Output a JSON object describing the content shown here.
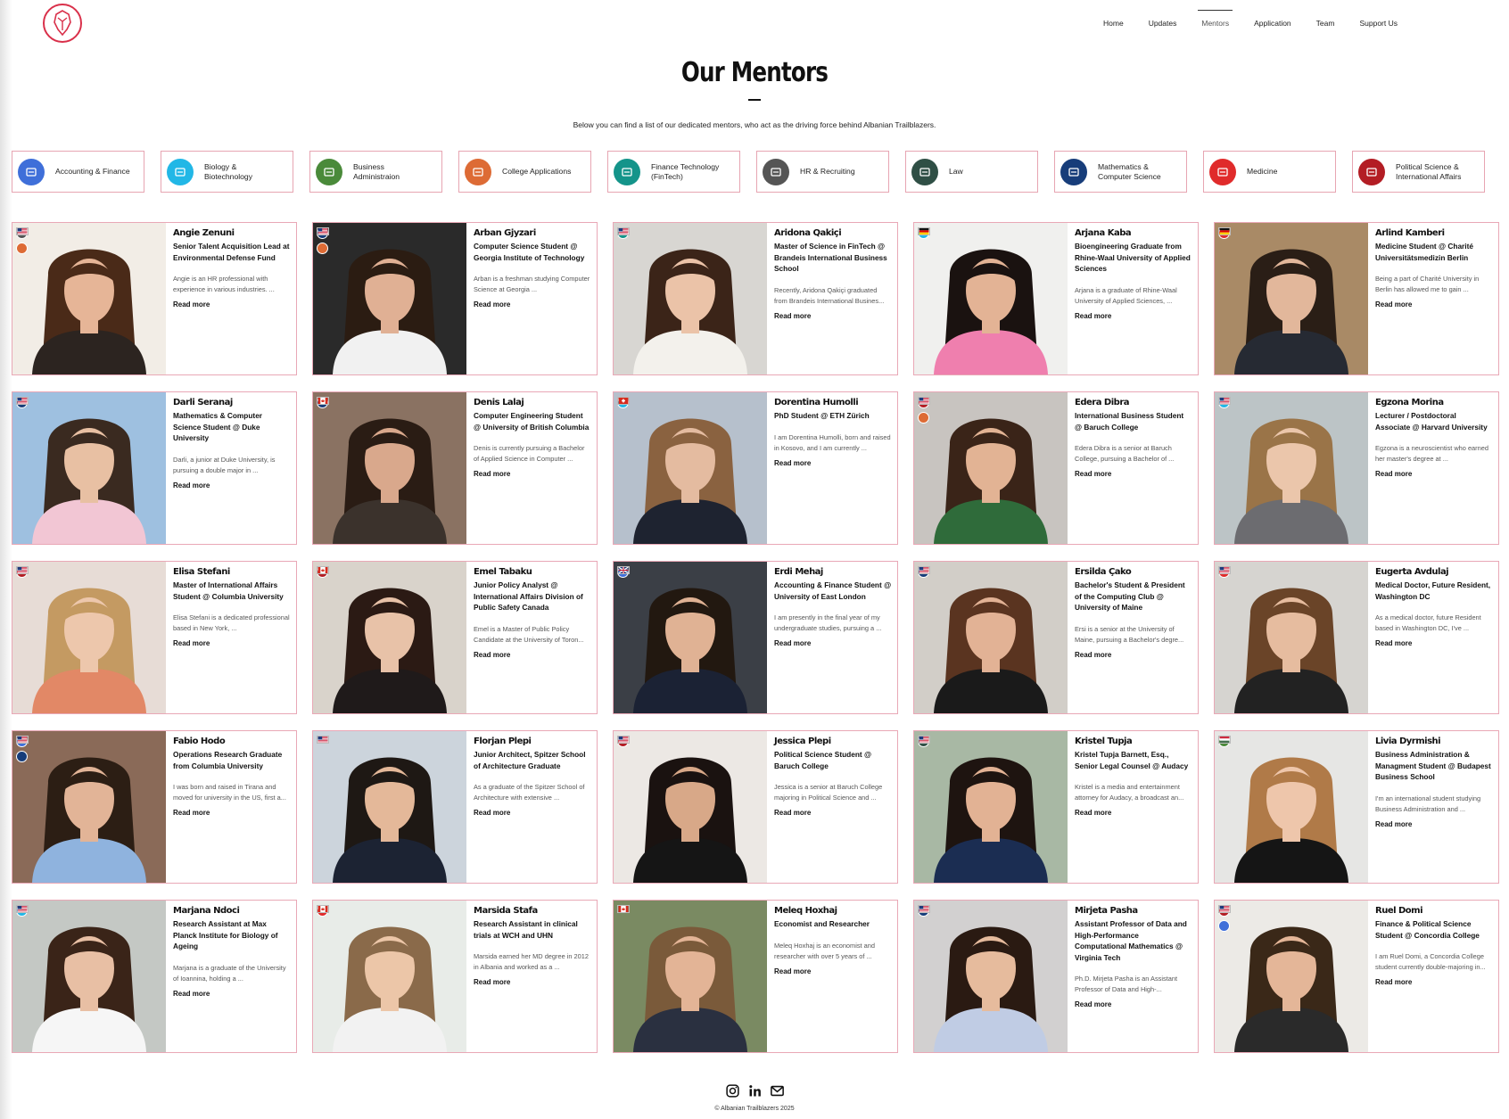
{
  "nav": [
    "Home",
    "Updates",
    "Mentors",
    "Application",
    "Team",
    "Support Us"
  ],
  "active_nav": "Mentors",
  "page": {
    "title": "Our Mentors",
    "subtitle": "Below you can find a list of our dedicated mentors, who act as the driving force behind Albanian Trailblazers."
  },
  "categories": [
    {
      "label": "Accounting & Finance",
      "color": "#3f6fd9",
      "icon": "money-icon"
    },
    {
      "label": "Biology &\nBiotechnology",
      "color": "#22b7e6",
      "icon": "microscope-icon"
    },
    {
      "label": "Business\nAdministraion",
      "color": "#4a8a3a",
      "icon": "building-icon"
    },
    {
      "label": "College Applications",
      "color": "#dd6b35",
      "icon": "college-icon"
    },
    {
      "label": "Finance Technology\n(FinTech)",
      "color": "#14948a",
      "icon": "fintech-icon"
    },
    {
      "label": "HR & Recruiting",
      "color": "#555555",
      "icon": "hr-icon"
    },
    {
      "label": "Law",
      "color": "#2f4f45",
      "icon": "scales-icon"
    },
    {
      "label": "Mathematics &\nComputer Science",
      "color": "#173d7a",
      "icon": "computer-icon"
    },
    {
      "label": "Medicine",
      "color": "#e02b2b",
      "icon": "medicine-icon"
    },
    {
      "label": "Political Science &\nInternational Affairs",
      "color": "#b31d24",
      "icon": "capitol-icon"
    }
  ],
  "read_more_label": "Read more",
  "mentors": [
    {
      "name": "Angie Zenuni",
      "role": "Senior Talent Acquisition Lead at Environmental Defense Fund",
      "bio": "Angie is an HR professional with experience in various industries. ...",
      "flag": "us",
      "badges": [
        "#555555",
        "#dd6b35"
      ],
      "bg": "#f2ede6",
      "skin": "#e6b597",
      "hair": "#4a2a18",
      "top": "#2c2420"
    },
    {
      "name": "Arban Gjyzari",
      "role": "Computer Science Student @ Georgia Institute of Technology",
      "bio": "Arban is a freshman studying Computer Science at Georgia ...",
      "flag": "us",
      "badges": [
        "#173d7a",
        "#dd6b35"
      ],
      "bg": "#2a2a2a",
      "skin": "#e0b094",
      "hair": "#2b1c12",
      "top": "#f1f1f1"
    },
    {
      "name": "Aridona Qakiçi",
      "role": "Master of Science in FinTech @ Brandeis International Business School",
      "bio": "Recently, Aridona Qakiçi graduated from Brandeis International Busines...",
      "flag": "us",
      "badges": [
        "#14948a"
      ],
      "bg": "#d8d6d2",
      "skin": "#ebc3a8",
      "hair": "#3b2418",
      "top": "#f3f1ec"
    },
    {
      "name": "Arjana Kaba",
      "role": "Bioengineering Graduate from Rhine-Waal University of Applied Sciences",
      "bio": "Arjana is a graduate of Rhine-Waal University of Applied Sciences, ...",
      "flag": "de",
      "badges": [
        "#22b7e6"
      ],
      "bg": "#f0f0ee",
      "skin": "#e3b395",
      "hair": "#1a1210",
      "top": "#ef7fae"
    },
    {
      "name": "Arlind Kamberi",
      "role": "Medicine Student @ Charité Universitätsmedizin Berlin",
      "bio": "Being a part of Charité University in Berlin has allowed me to gain ...",
      "flag": "de",
      "badges": [
        "#e02b2b"
      ],
      "bg": "#a98a66",
      "skin": "#e2b79b",
      "hair": "#2a1e16",
      "top": "#262a33"
    },
    {
      "name": "Darli Seranaj",
      "role": "Mathematics & Computer Science Student @ Duke University",
      "bio": "Darli, a junior at Duke University, is pursuing a double major in ...",
      "flag": "us",
      "badges": [
        "#173d7a"
      ],
      "bg": "#9ec0e0",
      "skin": "#e8c0a3",
      "hair": "#3a2a20",
      "top": "#f2c6d4"
    },
    {
      "name": "Denis Lalaj",
      "role": "Computer Engineering Student @ University of British Columbia",
      "bio": "Denis is currently pursuing a Bachelor of Applied Science in Computer ...",
      "flag": "ca",
      "badges": [
        "#173d7a"
      ],
      "bg": "#8a7262",
      "skin": "#d9a88c",
      "hair": "#2a1c14",
      "top": "#3b322c"
    },
    {
      "name": "Dorentina Humolli",
      "role": "PhD Student @ ETH Zürich",
      "bio": "I am Dorentina Humolli, born and raised in Kosovo, and I am currently ...",
      "flag": "ch",
      "badges": [
        "#22b7e6"
      ],
      "bg": "#b6c0cc",
      "skin": "#e4bba0",
      "hair": "#8a6240",
      "top": "#1e2330"
    },
    {
      "name": "Edera Dibra",
      "role": "International Business Student @ Baruch College",
      "bio": "Edera Dibra is a senior at Baruch College, pursuing a Bachelor of ...",
      "flag": "us",
      "badges": [
        "#b31d24",
        "#dd6b35"
      ],
      "bg": "#c8c4c0",
      "skin": "#e2b394",
      "hair": "#3a2418",
      "top": "#2f6b3a"
    },
    {
      "name": "Egzona Morina",
      "role": "Lecturer / Postdoctoral Associate @ Harvard University",
      "bio": "Egzona is a neuroscientist who earned her master's degree at ...",
      "flag": "us",
      "badges": [
        "#22b7e6"
      ],
      "bg": "#bcc4c6",
      "skin": "#ebc6ab",
      "hair": "#9a7448",
      "top": "#6c6c70"
    },
    {
      "name": "Elisa Stefani",
      "role": "Master of International Affairs Student @ Columbia University",
      "bio": "Elisa Stefani is a dedicated professional based in New York, ...",
      "flag": "us",
      "badges": [
        "#b31d24"
      ],
      "bg": "#e7dcd6",
      "skin": "#edc7ac",
      "hair": "#c49a62",
      "top": "#e28866"
    },
    {
      "name": "Emel Tabaku",
      "role": "Junior Policy Analyst @ International Affairs Division of Public Safety Canada",
      "bio": "Emel is a Master of Public Policy Candidate at the University of Toron...",
      "flag": "ca",
      "badges": [
        "#b31d24"
      ],
      "bg": "#d9d3cb",
      "skin": "#e8c2a8",
      "hair": "#2b1a14",
      "top": "#1f1a1a"
    },
    {
      "name": "Erdi Mehaj",
      "role": "Accounting & Finance Student @ University of East London",
      "bio": "I am presently in the final year of my undergraduate studies, pursuing a ...",
      "flag": "gb",
      "badges": [
        "#3f6fd9"
      ],
      "bg": "#3b3f46",
      "skin": "#e0b294",
      "hair": "#221810",
      "top": "#1b2234"
    },
    {
      "name": "Ersilda Çako",
      "role": "Bachelor's Student & President of the Computing Club @ University of Maine",
      "bio": "Ersi is a senior at the University of Maine, pursuing a Bachelor's degre...",
      "flag": "us",
      "badges": [
        "#173d7a"
      ],
      "bg": "#d2cec8",
      "skin": "#e2b295",
      "hair": "#5a3420",
      "top": "#1a1a1a"
    },
    {
      "name": "Eugerta Avdulaj",
      "role": "Medical Doctor, Future Resident, Washington DC",
      "bio": "As a medical doctor, future Resident based in Washington DC, I've ...",
      "flag": "us",
      "badges": [
        "#e02b2b"
      ],
      "bg": "#d6d4d0",
      "skin": "#e6bc9f",
      "hair": "#6a4428",
      "top": "#222222"
    },
    {
      "name": "Fabio Hodo",
      "role": "Operations Research Graduate from Columbia University",
      "bio": "I was born and raised in Tirana and moved for university in the US, first a...",
      "flag": "us",
      "badges": [
        "#3f6fd9",
        "#173d7a"
      ],
      "bg": "#8a6a58",
      "skin": "#e2b497",
      "hair": "#2c1e14",
      "top": "#8fb3de"
    },
    {
      "name": "Florjan Plepi",
      "role": "Junior Architect, Spitzer School of Architecture Graduate",
      "bio": "As a graduate of the Spitzer School of Architecture with extensive ...",
      "flag": "us",
      "badges": [],
      "bg": "#ccd4dc",
      "skin": "#e4b899",
      "hair": "#1e1814",
      "top": "#1c2333"
    },
    {
      "name": "Jessica Plepi",
      "role": "Political Science Student @ Baruch College",
      "bio": "Jessica is a senior at Baruch College majoring in Political Science and ...",
      "flag": "us",
      "badges": [
        "#b31d24"
      ],
      "bg": "#ece8e4",
      "skin": "#d8a888",
      "hair": "#1a1210",
      "top": "#151515"
    },
    {
      "name": "Kristel Tupja",
      "role": "Kristel Tupja Barnett, Esq., Senior Legal Counsel @ Audacy",
      "bio": "Kristel is a media and entertainment attorney for Audacy, a broadcast an...",
      "flag": "us",
      "badges": [
        "#2f4f45"
      ],
      "bg": "#a8b8a4",
      "skin": "#e2b294",
      "hair": "#1e1410",
      "top": "#1b2d52"
    },
    {
      "name": "Livia Dyrmishi",
      "role": "Business Administration & Managment Student @ Budapest Business School",
      "bio": "I'm an international student studying Business Administration and ...",
      "flag": "hu",
      "badges": [
        "#4a8a3a"
      ],
      "bg": "#e6e6e4",
      "skin": "#eec6ab",
      "hair": "#b07a48",
      "top": "#151515"
    },
    {
      "name": "Marjana Ndoci",
      "role": "Research Assistant at Max Planck Institute for Biology of Ageing",
      "bio": "Marjana is a graduate of the University of Ioannina, holding a ...",
      "flag": "us",
      "badges": [
        "#22b7e6"
      ],
      "bg": "#c4c8c4",
      "skin": "#e8bfa4",
      "hair": "#3a2418",
      "top": "#f6f6f6"
    },
    {
      "name": "Marsida Stafa",
      "role": "Research Assistant in clinical trials at WCH and UHN",
      "bio": "Marsida earned her MD degree in 2012 in Albania and worked as a ...",
      "flag": "ca",
      "badges": [
        "#e02b2b"
      ],
      "bg": "#e8ece8",
      "skin": "#ecc6a8",
      "hair": "#8a6a4a",
      "top": "#f2f2f2"
    },
    {
      "name": "Meleq Hoxhaj",
      "role": "Economist and Researcher",
      "bio": "Meleq Hoxhaj is an economist and researcher with over 5 years of ...",
      "flag": "ca",
      "badges": [],
      "bg": "#7a8a62",
      "skin": "#e3b496",
      "hair": "#7a5a3a",
      "top": "#2a3040"
    },
    {
      "name": "Mirjeta Pasha",
      "role": "Assistant Professor of Data and High-Performance Computational Mathematics @ Virginia Tech",
      "bio": "Ph.D. Mirjeta Pasha is an Assistant Professor of Data and High-...",
      "flag": "us",
      "badges": [
        "#173d7a"
      ],
      "bg": "#d2d0d0",
      "skin": "#e6bb9d",
      "hair": "#2a1a12",
      "top": "#c0cce4"
    },
    {
      "name": "Ruel Domi",
      "role": "Finance & Political Science Student @ Concordia College",
      "bio": "I am Ruel Domi, a Concordia College student currently double-majoring in...",
      "flag": "us",
      "badges": [
        "#b31d24",
        "#3f6fd9"
      ],
      "bg": "#eceae6",
      "skin": "#e4b698",
      "hair": "#3a2818",
      "top": "#2a2a2a"
    }
  ],
  "footer": {
    "social": [
      "instagram-icon",
      "linkedin-icon",
      "mail-icon"
    ],
    "copyright": "© Albanian Trailblazers 2025"
  }
}
